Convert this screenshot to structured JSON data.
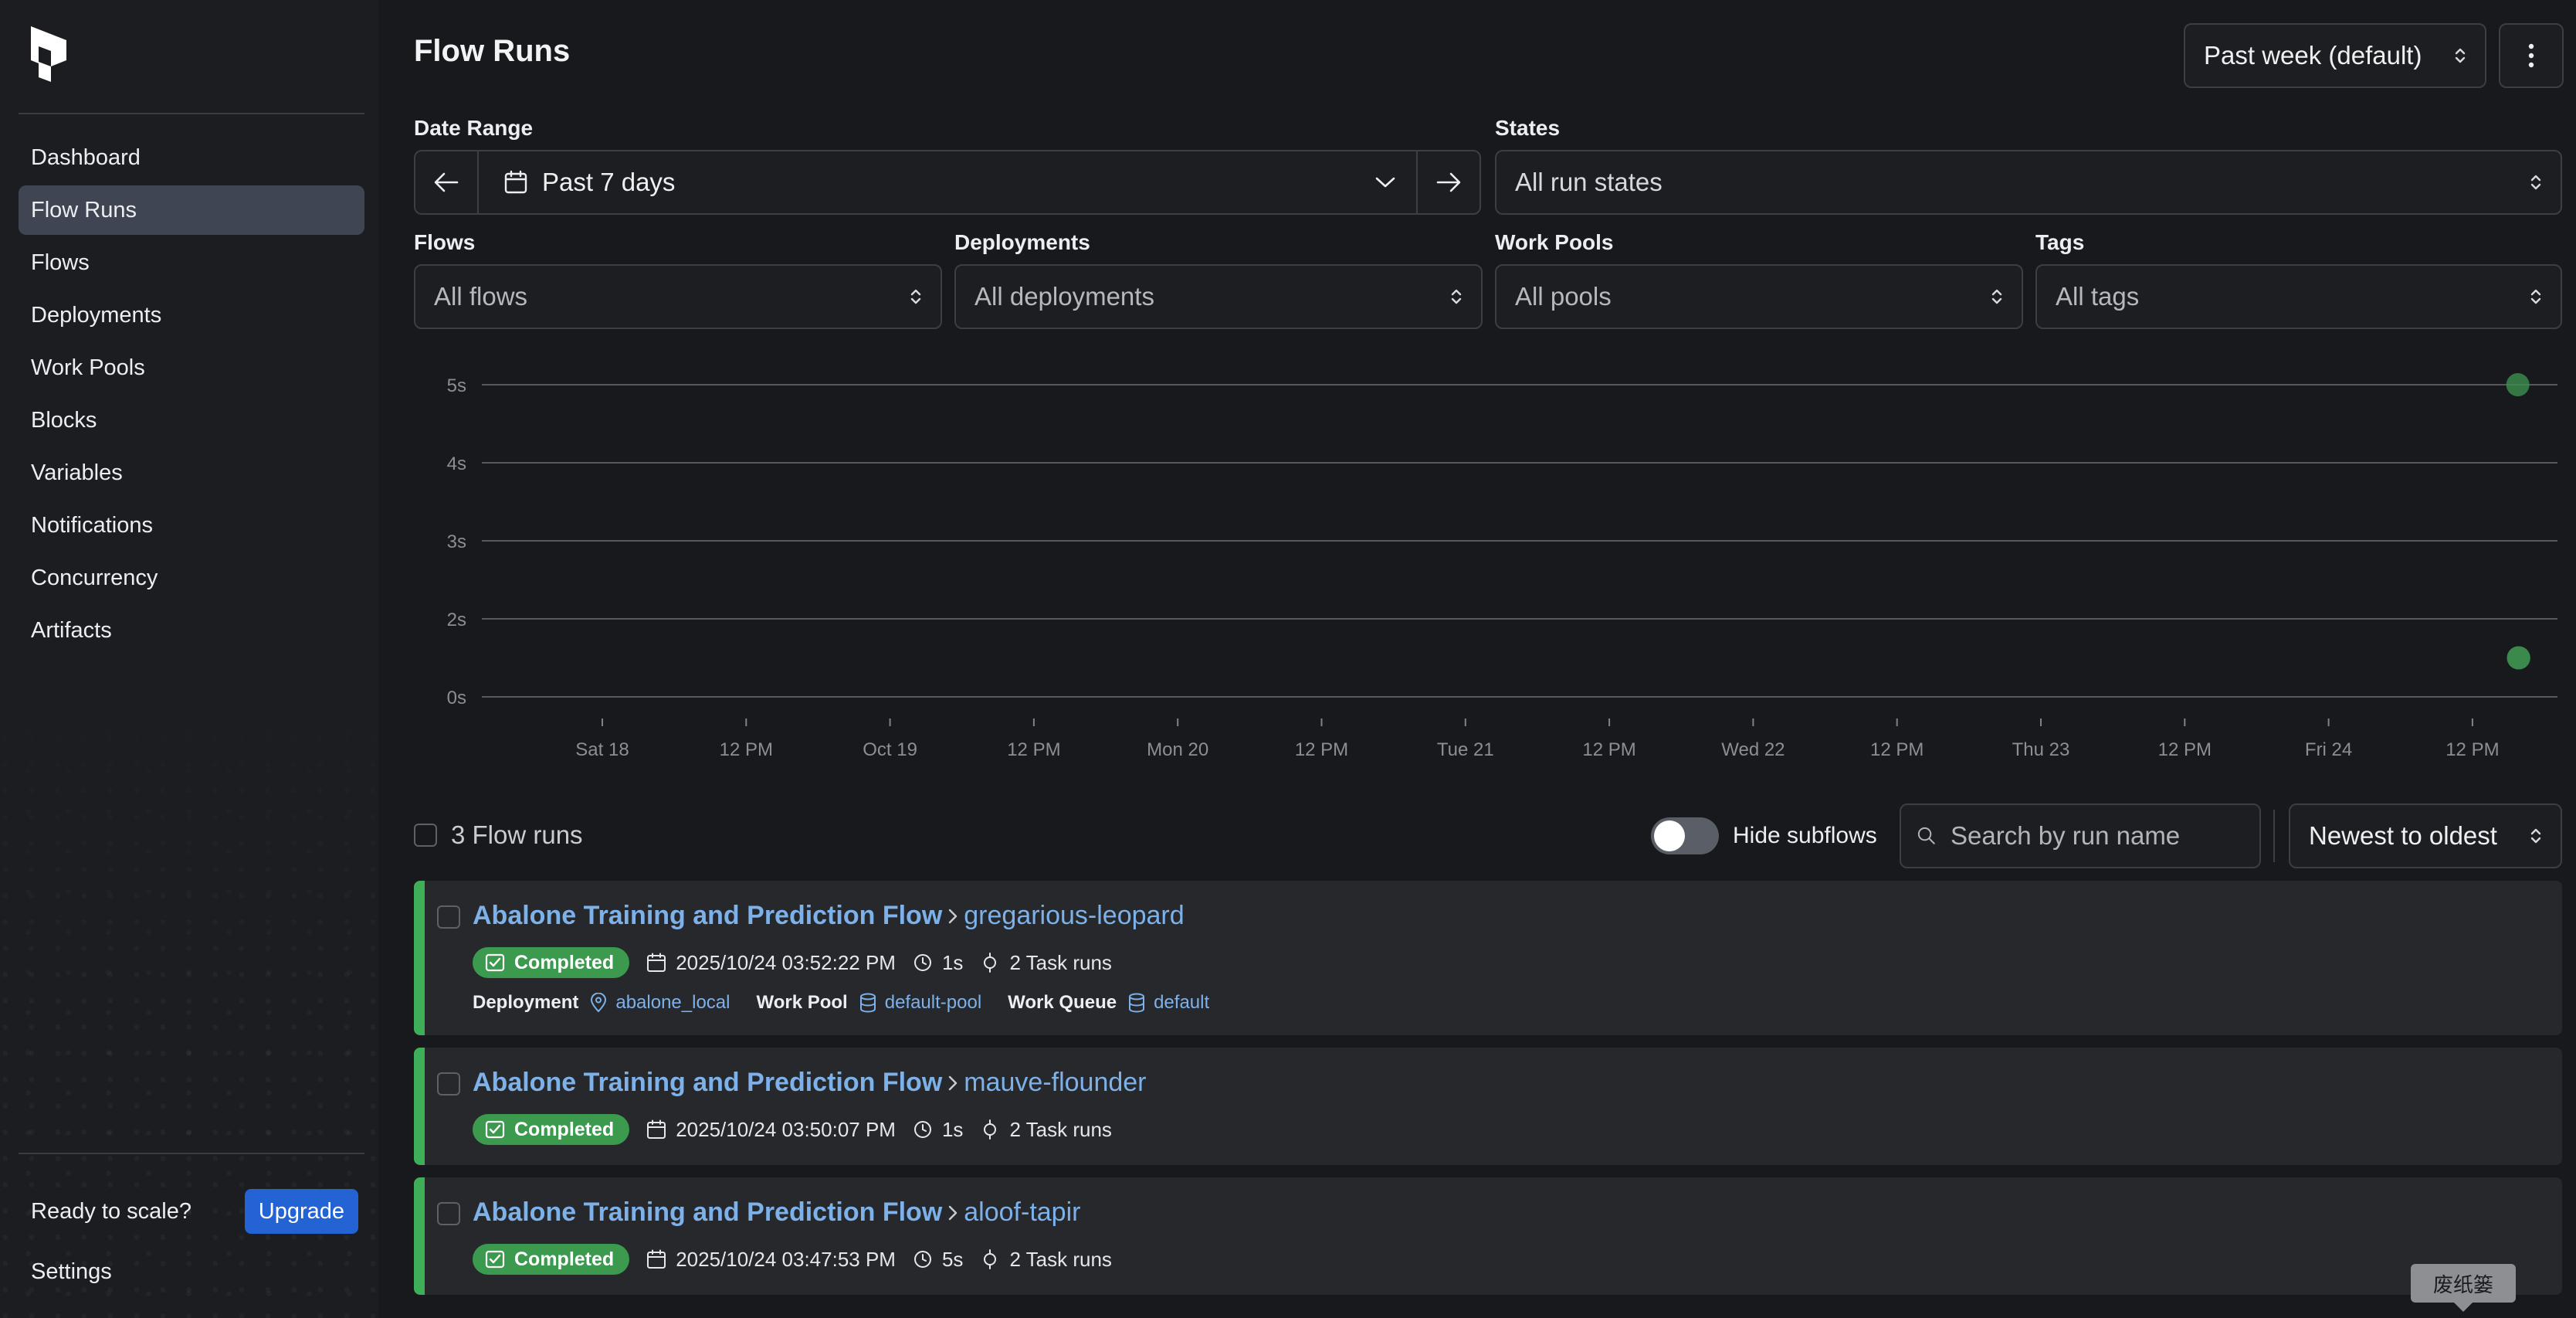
{
  "sidebar": {
    "nav": [
      "Dashboard",
      "Flow Runs",
      "Flows",
      "Deployments",
      "Work Pools",
      "Blocks",
      "Variables",
      "Notifications",
      "Concurrency",
      "Artifacts"
    ],
    "active": "Flow Runs",
    "upgrade_text": "Ready to scale?",
    "upgrade_button": "Upgrade",
    "settings": "Settings"
  },
  "header": {
    "title": "Flow Runs",
    "range_select": "Past week (default)"
  },
  "filters": {
    "date_range_label": "Date Range",
    "date_range_value": "Past 7 days",
    "states_label": "States",
    "states_value": "All run states",
    "flows_label": "Flows",
    "flows_value": "All flows",
    "deployments_label": "Deployments",
    "deployments_value": "All deployments",
    "work_pools_label": "Work Pools",
    "work_pools_value": "All pools",
    "tags_label": "Tags",
    "tags_value": "All tags"
  },
  "chart_data": {
    "type": "scatter",
    "title": "",
    "xlabel": "",
    "ylabel": "",
    "y_ticks": [
      "0s",
      "2s",
      "3s",
      "4s",
      "5s"
    ],
    "x_ticks": [
      "Sat 18",
      "12 PM",
      "Oct 19",
      "12 PM",
      "Mon 20",
      "12 PM",
      "Tue 21",
      "12 PM",
      "Wed 22",
      "12 PM",
      "Thu 23",
      "12 PM",
      "Fri 24",
      "12 PM"
    ],
    "points": [
      {
        "x": "2025-10-24 15:52",
        "y": 1,
        "label": "1s"
      },
      {
        "x": "2025-10-24 15:50",
        "y": 1,
        "label": "1s"
      },
      {
        "x": "2025-10-24 15:47",
        "y": 5,
        "label": "5s"
      }
    ],
    "point_color": "#3d8f4f",
    "grid": true
  },
  "list": {
    "count_label": "3 Flow runs",
    "hide_subflows_label": "Hide subflows",
    "search_placeholder": "Search by run name",
    "sort_value": "Newest to oldest"
  },
  "runs": [
    {
      "flow": "Abalone Training and Prediction Flow",
      "name": "gregarious-leopard",
      "state": "Completed",
      "time": "2025/10/24 03:52:22 PM",
      "duration": "1s",
      "tasks": "2 Task runs",
      "deployment_label": "Deployment",
      "deployment": "abalone_local",
      "work_pool_label": "Work Pool",
      "work_pool": "default-pool",
      "work_queue_label": "Work Queue",
      "work_queue": "default"
    },
    {
      "flow": "Abalone Training and Prediction Flow",
      "name": "mauve-flounder",
      "state": "Completed",
      "time": "2025/10/24 03:50:07 PM",
      "duration": "1s",
      "tasks": "2 Task runs"
    },
    {
      "flow": "Abalone Training and Prediction Flow",
      "name": "aloof-tapir",
      "state": "Completed",
      "time": "2025/10/24 03:47:53 PM",
      "duration": "5s",
      "tasks": "2 Task runs"
    }
  ],
  "tooltip": "废纸篓"
}
